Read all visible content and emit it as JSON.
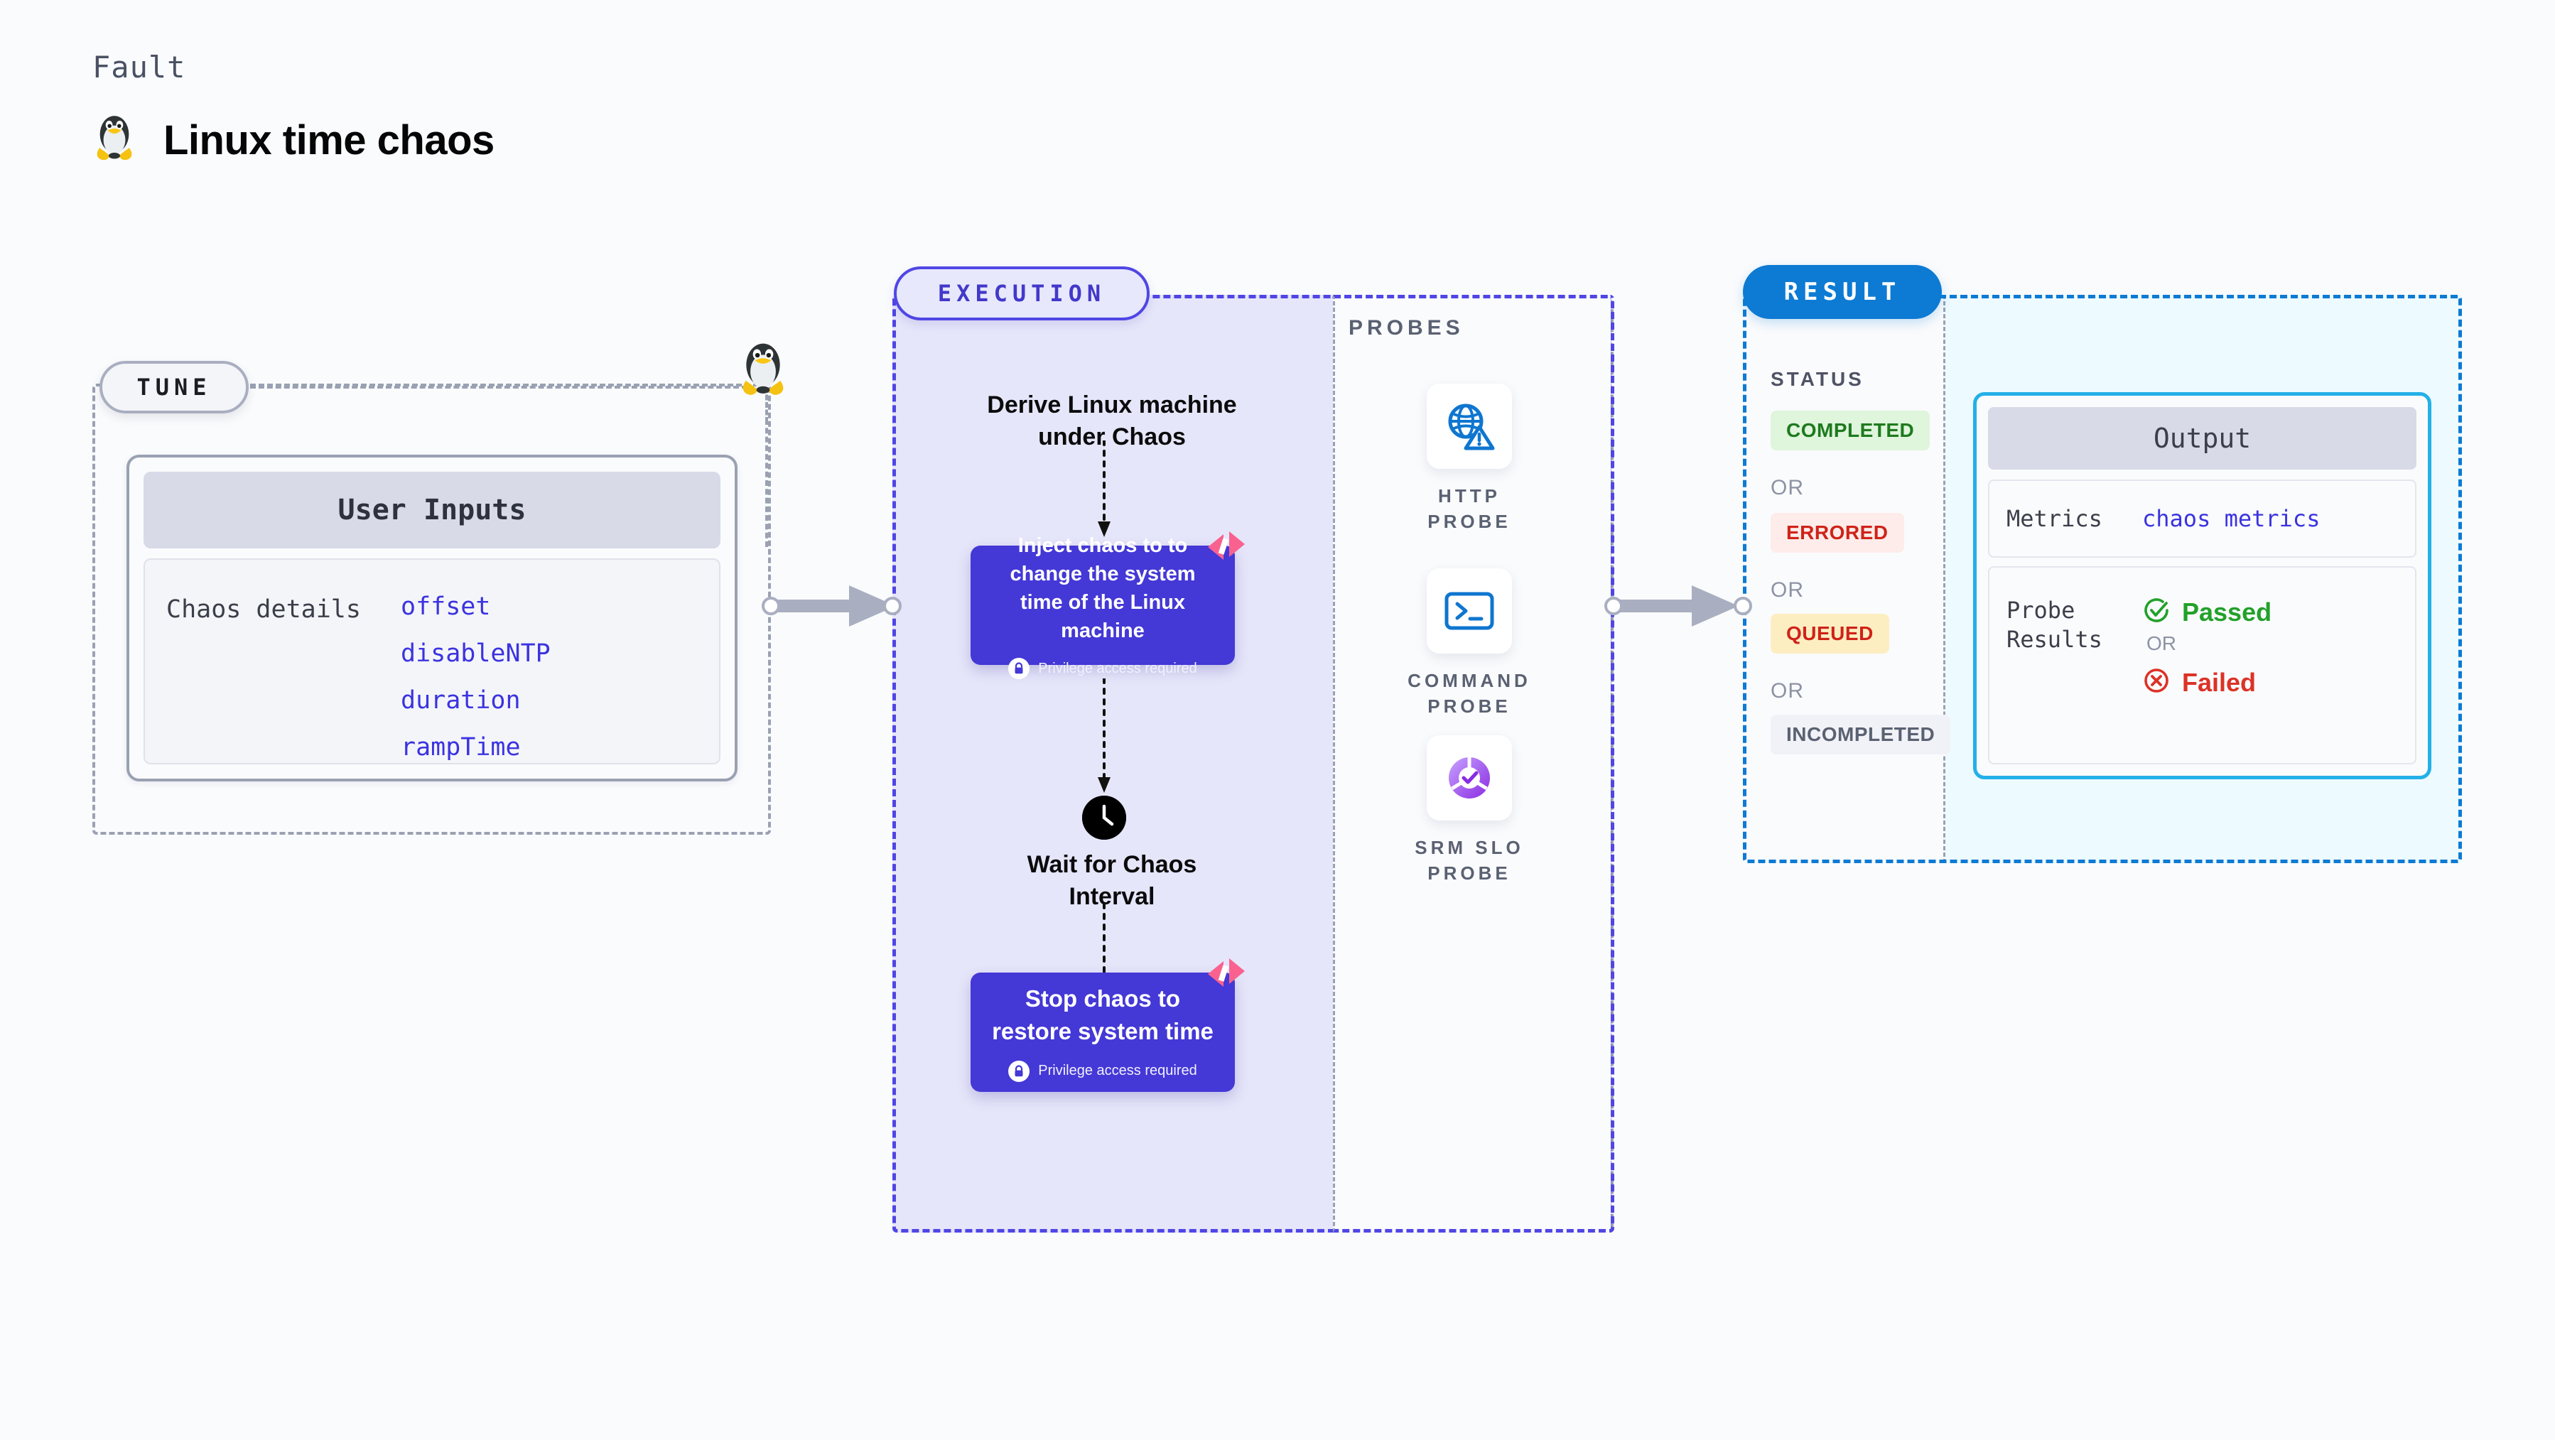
{
  "header": {
    "eyebrow": "Fault",
    "title": "Linux time chaos",
    "icon": "linux-penguin-icon"
  },
  "tune": {
    "tag": "TUNE",
    "card_title": "User Inputs",
    "row_label": "Chaos details",
    "params": [
      "offset",
      "disableNTP",
      "duration",
      "rampTime"
    ],
    "edge_icon": "linux-penguin-icon"
  },
  "execution": {
    "tag": "EXECUTION",
    "step1_title": "Derive Linux machine\nunder Chaos",
    "step2": {
      "title": "Inject chaos to to change the system time of the Linux machine",
      "privilege": "Privilege access required",
      "badge_icon": "harness-logo-icon",
      "lock_icon": "lock-icon"
    },
    "wait": {
      "icon": "clock-icon",
      "title": "Wait for Chaos\nInterval"
    },
    "step3": {
      "title": "Stop chaos to\nrestore system time",
      "privilege": "Privilege access required",
      "badge_icon": "harness-logo-icon",
      "lock_icon": "lock-icon"
    }
  },
  "probes": {
    "label": "PROBES",
    "items": [
      {
        "name": "HTTP PROBE",
        "icon": "globe-warning-icon"
      },
      {
        "name": "COMMAND PROBE",
        "icon": "terminal-prompt-icon"
      },
      {
        "name": "SRM SLO PROBE",
        "icon": "srm-slo-donut-check-icon"
      }
    ]
  },
  "result": {
    "tag": "RESULT",
    "status_label": "STATUS",
    "or_label": "OR",
    "statuses": [
      {
        "label": "COMPLETED",
        "bg": "#dff5dc",
        "fg": "#1e7a1e"
      },
      {
        "label": "ERRORED",
        "bg": "#fdecea",
        "fg": "#cf2318"
      },
      {
        "label": "QUEUED",
        "bg": "#fdeec2",
        "fg": "#cf2318"
      },
      {
        "label": "INCOMPLETED",
        "bg": "#f1f2f7",
        "fg": "#5a6172"
      }
    ],
    "output": {
      "title": "Output",
      "metrics_key": "Metrics",
      "metrics_value": "chaos metrics",
      "probe_key": "Probe\nResults",
      "passed": {
        "label": "Passed",
        "color": "#22a12a",
        "icon": "check-circle-icon"
      },
      "or_label": "OR",
      "failed": {
        "label": "Failed",
        "color": "#dc3226",
        "icon": "x-circle-icon"
      }
    }
  },
  "colors": {
    "background": "#fafbfd",
    "tune_border": "#9aa1b2",
    "execution_border": "#4f46e5",
    "execution_fill": "#e6e6fa",
    "result_border": "#0d7ad3",
    "output_fill": "#edfaff",
    "output_card_border": "#24b0e8",
    "flow_box": "#4438d6",
    "param_text": "#3b33e0",
    "harness_pink": "#f9628f",
    "probe_blue": "#0f76d0"
  }
}
